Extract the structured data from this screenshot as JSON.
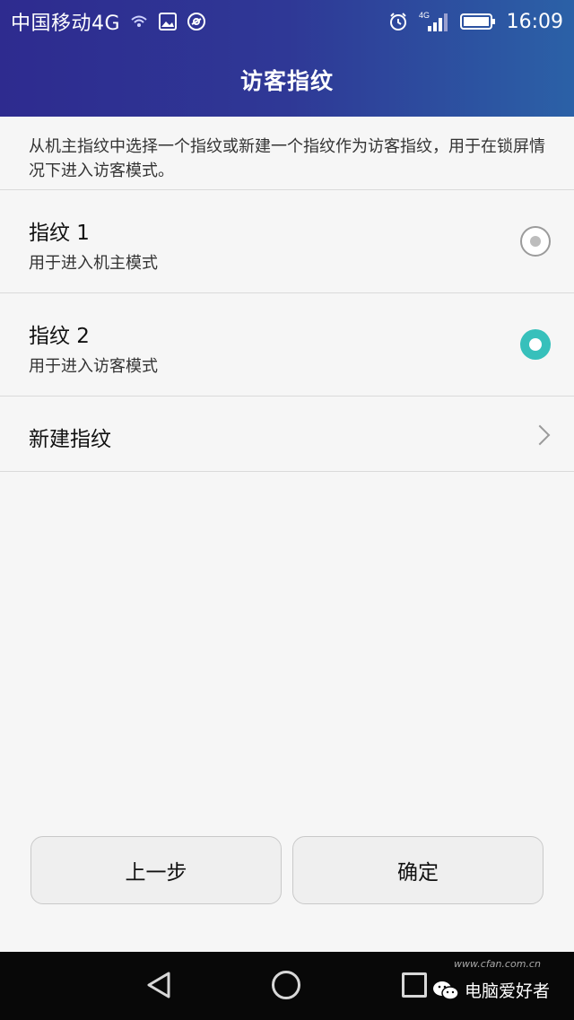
{
  "status": {
    "carrier": "中国移动4G",
    "network_badge": "4G",
    "time": "16:09",
    "icons": [
      "wifi-icon",
      "image-icon",
      "vpn-icon",
      "alarm-icon",
      "signal-icon",
      "battery-icon"
    ]
  },
  "header": {
    "title": "访客指纹"
  },
  "description": "从机主指纹中选择一个指纹或新建一个指纹作为访客指纹，用于在锁屏情况下进入访客模式。",
  "items": [
    {
      "title": "指纹 1",
      "subtitle": "用于进入机主模式",
      "selected": false
    },
    {
      "title": "指纹 2",
      "subtitle": "用于进入访客模式",
      "selected": true
    }
  ],
  "new_item": {
    "label": "新建指纹"
  },
  "buttons": {
    "prev": "上一步",
    "confirm": "确定"
  },
  "navbar": {
    "icons": [
      "back-icon",
      "home-icon",
      "recent-apps-icon"
    ]
  },
  "watermark": {
    "text": "电脑爱好者",
    "url": "www.cfan.com.cn"
  },
  "colors": {
    "header": "#2e3592",
    "accent": "#37c0bb",
    "background": "#f6f6f6"
  }
}
